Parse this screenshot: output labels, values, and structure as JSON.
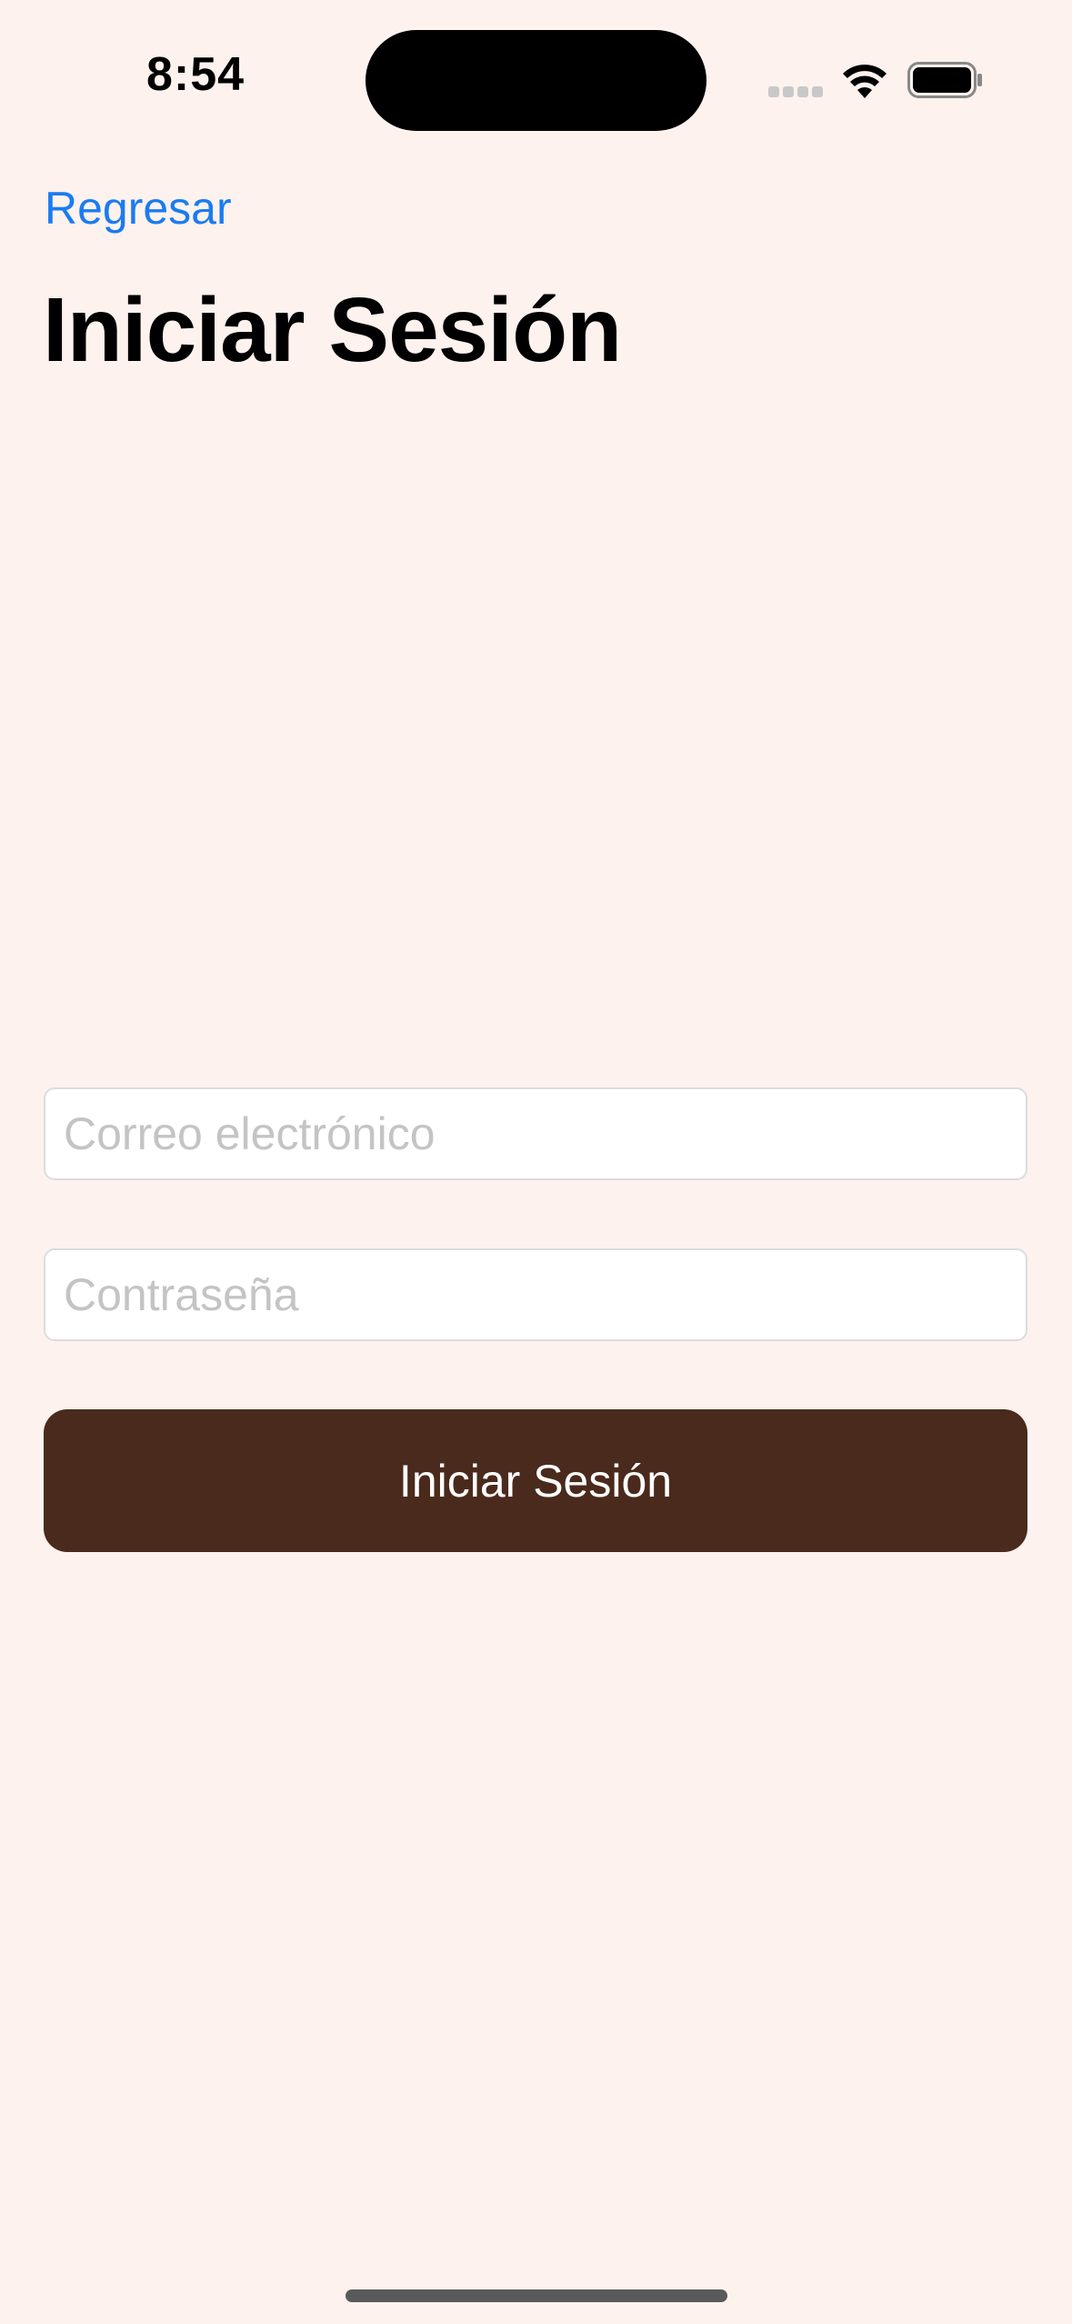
{
  "status_bar": {
    "time": "8:54",
    "icons": [
      "cellular-signal-icon",
      "wifi-icon",
      "battery-icon"
    ]
  },
  "nav": {
    "back_label": "Regresar"
  },
  "page": {
    "title": "Iniciar Sesión"
  },
  "form": {
    "email": {
      "value": "",
      "placeholder": "Correo electrónico"
    },
    "password": {
      "value": "",
      "placeholder": "Contraseña"
    },
    "submit_label": "Iniciar Sesión"
  },
  "colors": {
    "background": "#fdf2ee",
    "link": "#1a7cf0",
    "primary_button": "#4a2a1c",
    "primary_button_text": "#ffffff"
  }
}
